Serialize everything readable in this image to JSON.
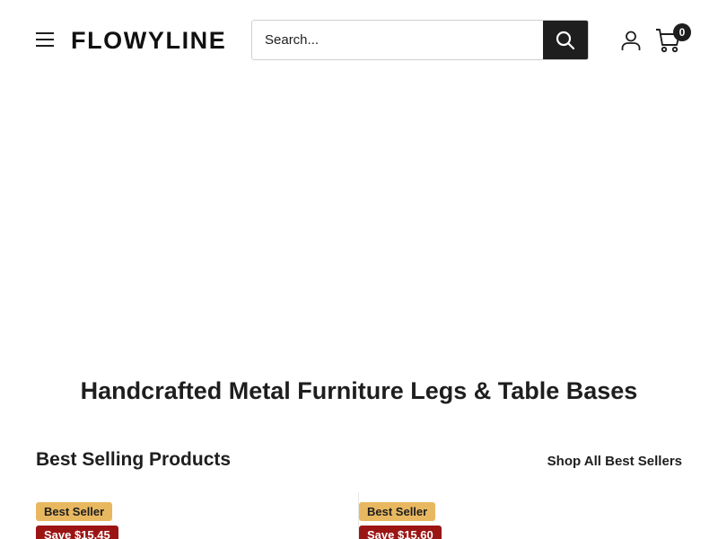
{
  "header": {
    "logo": "FLOWYLINE",
    "search_placeholder": "Search...",
    "cart_count": "0",
    "icons": {
      "menu": "hamburger-menu-icon",
      "search": "search-icon",
      "account": "user-icon",
      "cart": "shopping-cart-icon"
    }
  },
  "main": {
    "headline": "Handcrafted Metal Furniture Legs & Table Bases",
    "best_selling": {
      "title": "Best Selling Products",
      "shop_all_label": "Shop All Best Sellers",
      "products": [
        {
          "badge": "Best Seller",
          "save_label": "Save $15.45"
        },
        {
          "badge": "Best Seller",
          "save_label": "Save $15.60"
        }
      ]
    }
  },
  "colors": {
    "text": "#1e1e1e",
    "best_seller_badge": "#e8b860",
    "save_badge": "#9c1515"
  }
}
